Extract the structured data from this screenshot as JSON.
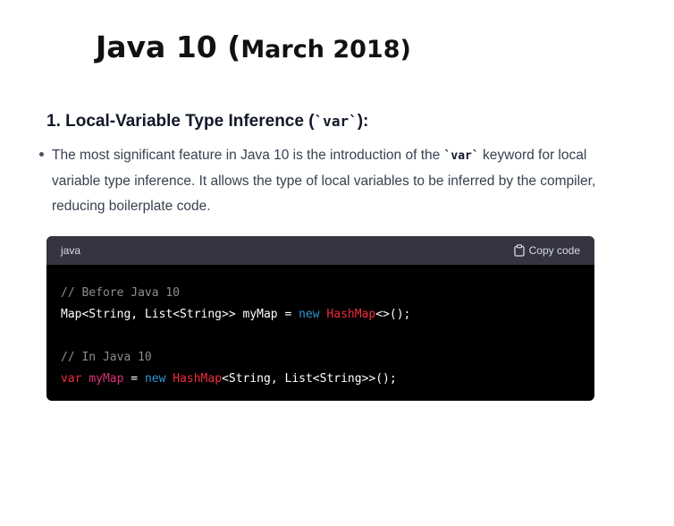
{
  "title": {
    "main": "Java 10 (",
    "sub": "March 2018)"
  },
  "section": {
    "heading_prefix": "1. Local-Variable Type Inference (",
    "heading_code": "`var`",
    "heading_suffix": "):"
  },
  "paragraph": {
    "part1": "The most significant feature in Java 10 is the introduction of the ",
    "code": "`var`",
    "part2": " keyword for local variable type inference. It allows the type of local variables to be inferred by the compiler, reducing boilerplate code."
  },
  "codeblock": {
    "language": "java",
    "copy_label": "Copy code",
    "line1_comment": "// Before Java 10",
    "line2_a": "Map<String, List<String>> myMap = ",
    "line2_new": "new",
    "line2_space": " ",
    "line2_cls": "HashMap",
    "line2_b": "<>();",
    "line4_comment": "// In Java 10",
    "line5_var": "var",
    "line5_space": " ",
    "line5_name": "myMap",
    "line5_eq": " = ",
    "line5_new": "new",
    "line5_space2": " ",
    "line5_cls": "HashMap",
    "line5_b": "<String, List<String>>();"
  },
  "colors": {
    "keyword": "#2e95d3",
    "class": "#f22c3d",
    "comment": "#8e8e8e",
    "variable": "#df3079"
  },
  "icons": {
    "copy": "clipboard-icon"
  }
}
